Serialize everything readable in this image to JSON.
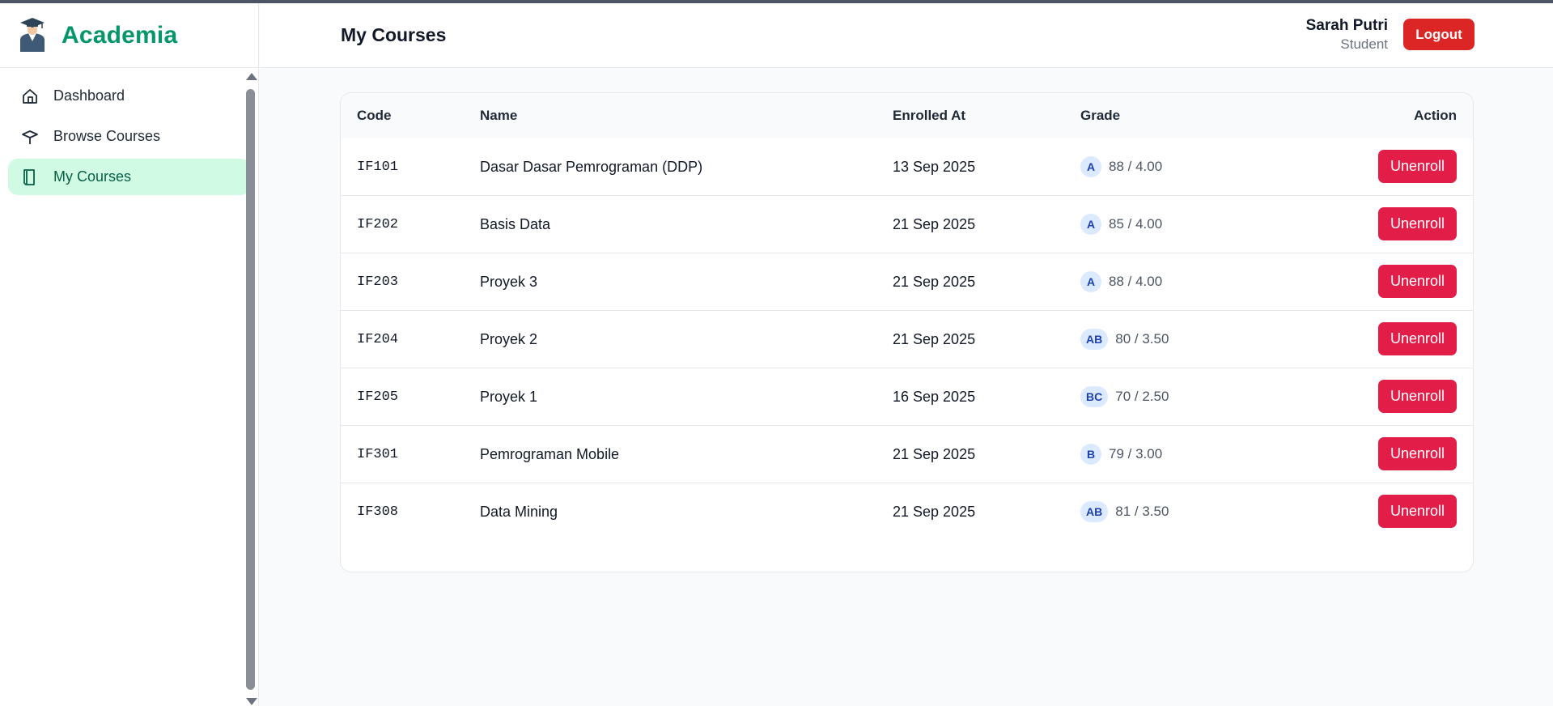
{
  "brand": {
    "name": "Academia",
    "logo_icon": "graduate-avatar-icon"
  },
  "sidebar": {
    "items": [
      {
        "label": "Dashboard",
        "icon": "home-icon",
        "active": false
      },
      {
        "label": "Browse Courses",
        "icon": "graduation-cap-icon",
        "active": false
      },
      {
        "label": "My Courses",
        "icon": "book-icon",
        "active": true
      }
    ]
  },
  "header": {
    "title": "My Courses",
    "user_name": "Sarah Putri",
    "user_role": "Student",
    "logout_label": "Logout"
  },
  "table": {
    "columns": [
      "Code",
      "Name",
      "Enrolled At",
      "Grade",
      "Action"
    ],
    "action_label": "Unenroll",
    "rows": [
      {
        "code": "IF101",
        "name": "Dasar Dasar Pemrograman (DDP)",
        "enrolled_at": "13 Sep 2025",
        "grade": "A",
        "score": "88 / 4.00"
      },
      {
        "code": "IF202",
        "name": "Basis Data",
        "enrolled_at": "21 Sep 2025",
        "grade": "A",
        "score": "85 / 4.00"
      },
      {
        "code": "IF203",
        "name": "Proyek 3",
        "enrolled_at": "21 Sep 2025",
        "grade": "A",
        "score": "88 / 4.00"
      },
      {
        "code": "IF204",
        "name": "Proyek 2",
        "enrolled_at": "21 Sep 2025",
        "grade": "AB",
        "score": "80 / 3.50"
      },
      {
        "code": "IF205",
        "name": "Proyek 1",
        "enrolled_at": "16 Sep 2025",
        "grade": "BC",
        "score": "70 / 2.50"
      },
      {
        "code": "IF301",
        "name": "Pemrograman Mobile",
        "enrolled_at": "21 Sep 2025",
        "grade": "B",
        "score": "79 / 3.00"
      },
      {
        "code": "IF308",
        "name": "Data Mining",
        "enrolled_at": "21 Sep 2025",
        "grade": "AB",
        "score": "81 / 3.50"
      }
    ]
  },
  "colors": {
    "brand": "#059669",
    "active_nav_bg": "#d1fae5",
    "logout": "#dc2626",
    "unenroll": "#e11d48",
    "grade_badge_bg": "#dbeafe",
    "grade_badge_text": "#1e40af"
  }
}
